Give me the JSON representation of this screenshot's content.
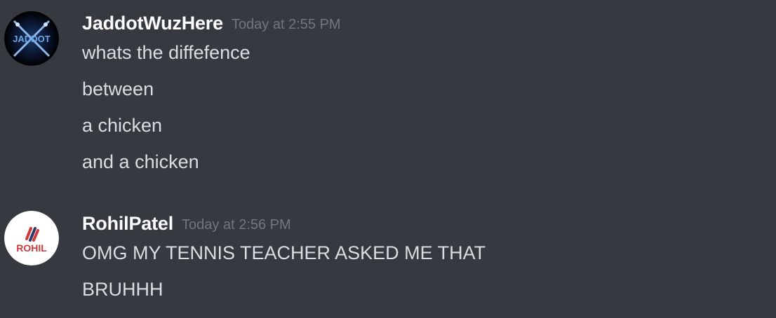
{
  "messages": [
    {
      "username": "JaddotWuzHere",
      "timestamp": "Today at 2:55 PM",
      "avatar_icon": "jaddot-crossed-swords-avatar",
      "avatar_text": "JADDOT",
      "lines": [
        "whats the diffefence",
        "between",
        "a chicken",
        "and a chicken"
      ]
    },
    {
      "username": "RohilPatel",
      "timestamp": "Today at 2:56 PM",
      "avatar_icon": "rohil-logo-avatar",
      "avatar_text": "ROHIL",
      "lines": [
        "OMG MY TENNIS TEACHER ASKED ME THAT",
        "BRUHHH"
      ]
    }
  ],
  "colors": {
    "background": "#36393f",
    "username": "#ffffff",
    "timestamp": "#72767d",
    "message_text": "#dcddde",
    "rohil_red": "#d0393b",
    "rohil_navy": "#2b3a67"
  }
}
